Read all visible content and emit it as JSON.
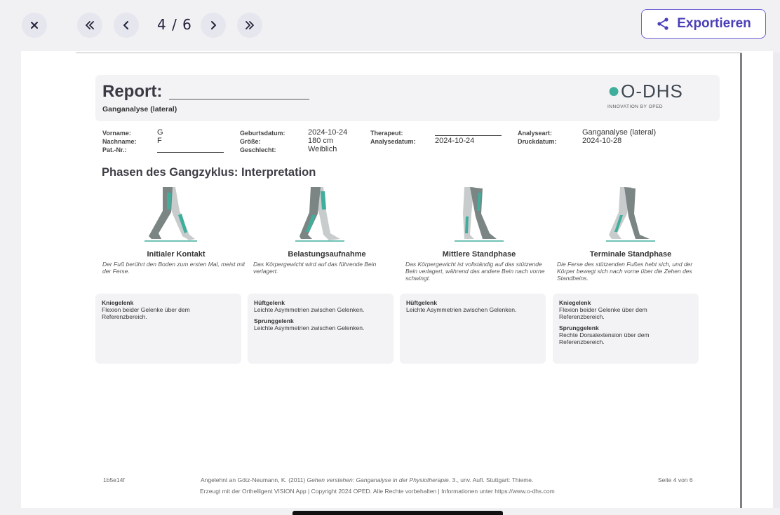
{
  "toolbar": {
    "page_indicator": "4 / 6",
    "export_label": "Exportieren"
  },
  "report": {
    "title": "Report:",
    "subtitle": "Ganganalyse (lateral)",
    "logo_text": "O-DHS",
    "logo_tagline": "INNOVATION BY OPED"
  },
  "patient": {
    "vorname_label": "Vorname:",
    "vorname": "G",
    "nachname_label": "Nachname:",
    "nachname": "F",
    "patnr_label": "Pat.-Nr.:",
    "geburtsdatum_label": "Geburtsdatum:",
    "geburtsdatum": "2024-10-24",
    "groesse_label": "Größe:",
    "groesse": "180 cm",
    "geschlecht_label": "Geschlecht:",
    "geschlecht": "Weiblich",
    "therapeut_label": "Therapeut:",
    "analysedatum_label": "Analysedatum:",
    "analysedatum": "2024-10-24",
    "analyseart_label": "Analyseart:",
    "analyseart": "Ganganalyse (lateral)",
    "druckdatum_label": "Druckdatum:",
    "druckdatum": "2024-10-28"
  },
  "section_title": "Phasen des Gangzyklus: Interpretation",
  "phases": [
    {
      "title": "Initialer Kontakt",
      "desc": "Der Fuß berührt den Boden zum ersten Mal, meist mit der Ferse."
    },
    {
      "title": "Belastungsaufnahme",
      "desc": "Das Körpergewicht wird auf das führende Bein verlagert."
    },
    {
      "title": "Mittlere Standphase",
      "desc": "Das Körpergewicht ist vollständig auf das stützende Bein verlagert, während das andere Bein nach vorne schwingt."
    },
    {
      "title": "Terminale Standphase",
      "desc": "Die Ferse des stützenden Fußes hebt sich, und der Körper bewegt sich nach vorne über die Zehen des Standbeins."
    }
  ],
  "joints": [
    {
      "items": [
        {
          "name": "Kniegelenk",
          "text": "Flexion beider Gelenke über dem Referenzbereich."
        }
      ]
    },
    {
      "items": [
        {
          "name": "Hüftgelenk",
          "text": "Leichte Asymmetrien zwischen Gelenken."
        },
        {
          "name": "Sprunggelenk",
          "text": "Leichte Asymmetrien zwischen Gelenken."
        }
      ]
    },
    {
      "items": [
        {
          "name": "Hüftgelenk",
          "text": "Leichte Asymmetrien zwischen Gelenken."
        }
      ]
    },
    {
      "items": [
        {
          "name": "Kniegelenk",
          "text": "Flexion beider Gelenke über dem Referenzbereich."
        },
        {
          "name": "Sprunggelenk",
          "text": "Rechte Dorsalextension über dem Referenzbereich."
        }
      ]
    }
  ],
  "footer": {
    "id": "1b5e14f",
    "citation_pre": "Angelehnt an Götz-Neumann, K. (2011) ",
    "citation_title": "Gehen verstehen: Ganganalyse in der Physiotherapie",
    "citation_post": ". 3., unv. Aufl. Stuttgart: Thieme.",
    "page": "Seite 4 von 6",
    "generated": "Erzeugt mit der Orthelligent VISION App | Copyright 2024 OPED. Alle Rechte vorbehalten | Informationen unter https://www.o-dhs.com"
  },
  "colors": {
    "accent": "#5b54c9",
    "teal": "#3fae9c",
    "leg_dark": "#7a8584",
    "leg_light": "#c9cccd"
  }
}
